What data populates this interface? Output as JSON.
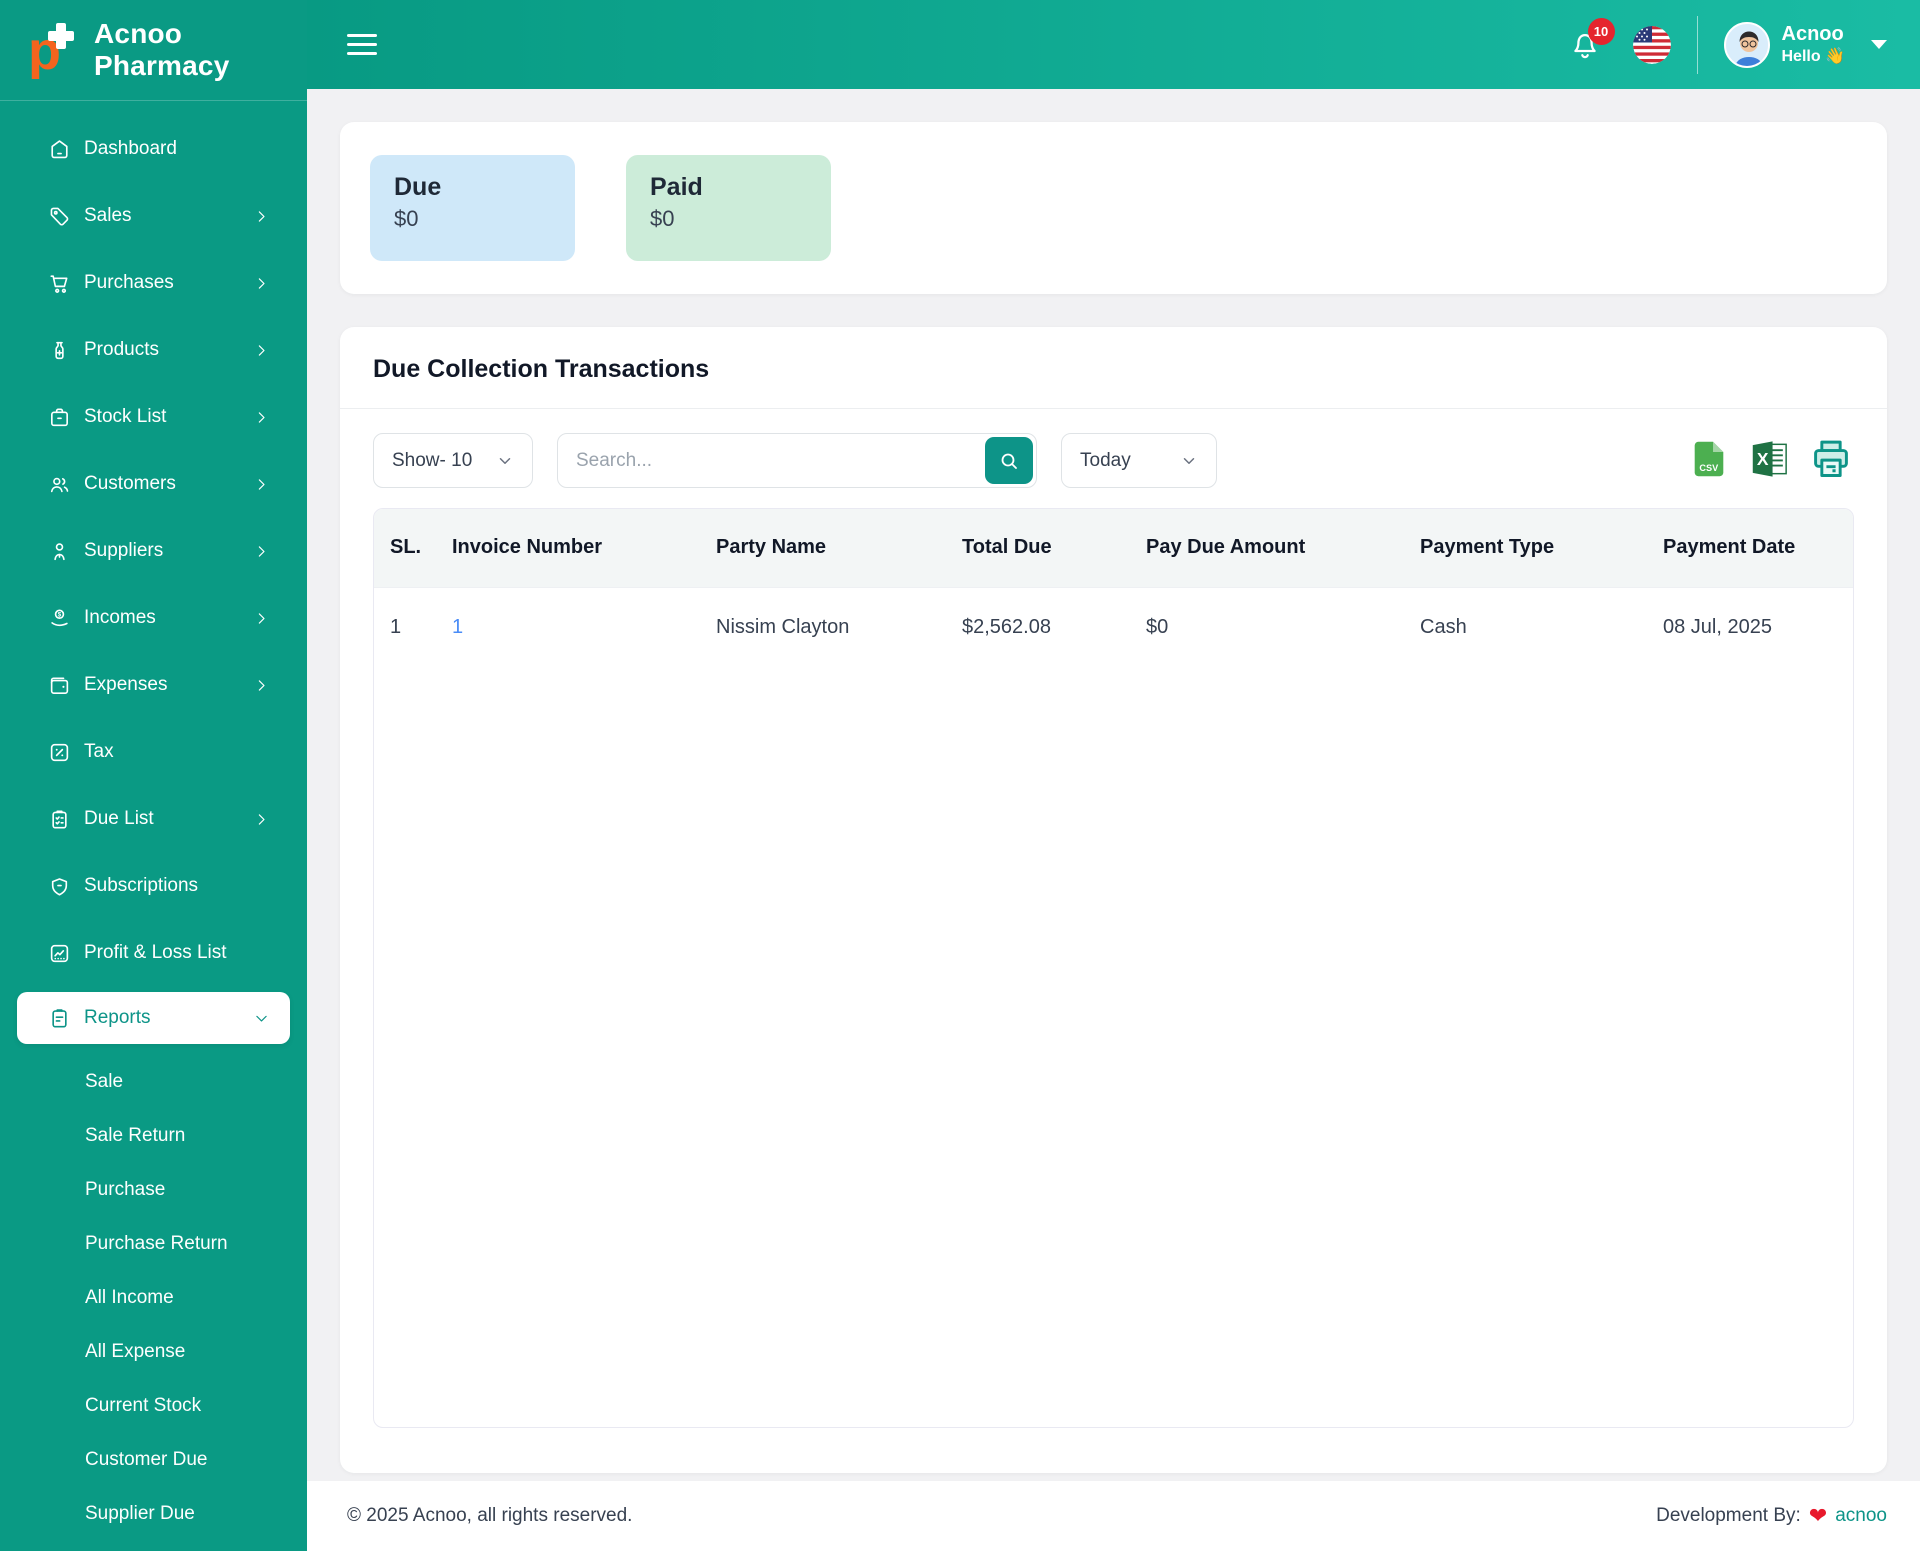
{
  "brand": {
    "name": "Acnoo Pharmacy"
  },
  "header": {
    "notification_count": "10",
    "user_name": "Acnoo",
    "greeting": "Hello",
    "wave_emoji": "👋"
  },
  "sidebar": {
    "items": [
      {
        "label": "Dashboard",
        "icon": "home",
        "chevron": "none",
        "active": false
      },
      {
        "label": "Sales",
        "icon": "tag",
        "chevron": "right",
        "active": false
      },
      {
        "label": "Purchases",
        "icon": "cart",
        "chevron": "right",
        "active": false
      },
      {
        "label": "Products",
        "icon": "bottle",
        "chevron": "right",
        "active": false
      },
      {
        "label": "Stock List",
        "icon": "box",
        "chevron": "right",
        "active": false
      },
      {
        "label": "Customers",
        "icon": "users",
        "chevron": "right",
        "active": false
      },
      {
        "label": "Suppliers",
        "icon": "user",
        "chevron": "right",
        "active": false
      },
      {
        "label": "Incomes",
        "icon": "coins",
        "chevron": "right",
        "active": false
      },
      {
        "label": "Expenses",
        "icon": "wallet",
        "chevron": "right",
        "active": false
      },
      {
        "label": "Tax",
        "icon": "percent",
        "chevron": "none",
        "active": false
      },
      {
        "label": "Due List",
        "icon": "clipboard-check",
        "chevron": "right",
        "active": false
      },
      {
        "label": "Subscriptions",
        "icon": "shield",
        "chevron": "none",
        "active": false
      },
      {
        "label": "Profit & Loss List",
        "icon": "chart",
        "chevron": "none",
        "active": false
      },
      {
        "label": "Reports",
        "icon": "clipboard",
        "chevron": "down",
        "active": true
      }
    ],
    "report_subitems": [
      "Sale",
      "Sale Return",
      "Purchase",
      "Purchase Return",
      "All Income",
      "All Expense",
      "Current Stock",
      "Customer Due",
      "Supplier Due"
    ]
  },
  "summary": {
    "cards": [
      {
        "title": "Due",
        "value": "$0",
        "bg": "#cfe8f9"
      },
      {
        "title": "Paid",
        "value": "$0",
        "bg": "#ccecd9"
      }
    ]
  },
  "section": {
    "title": "Due Collection Transactions",
    "show_select": "Show- 10",
    "search_placeholder": "Search...",
    "date_select": "Today",
    "export": [
      "csv",
      "excel",
      "print"
    ]
  },
  "table": {
    "columns": [
      "SL.",
      "Invoice Number",
      "Party Name",
      "Total Due",
      "Pay Due Amount",
      "Payment Type",
      "Payment Date"
    ],
    "rows": [
      {
        "sl": "1",
        "invoice": "1",
        "party": "Nissim Clayton",
        "total_due": "$2,562.08",
        "pay_due": "$0",
        "type": "Cash",
        "date": "08 Jul, 2025"
      }
    ]
  },
  "footer": {
    "copyright": "© 2025 Acnoo, all rights reserved.",
    "dev_prefix": "Development By:",
    "dev_link": "acnoo"
  },
  "colors": {
    "accent": "#0d9488",
    "sidebar_bg": "#0a9a84",
    "header_gradient_start": "#089a83",
    "header_gradient_end": "#1abca4",
    "due_card_bg": "#cfe8f9",
    "paid_card_bg": "#ccecd9",
    "link_blue": "#4a8cf7",
    "badge_red": "#e5252e",
    "logo_orange": "#f4641e"
  }
}
